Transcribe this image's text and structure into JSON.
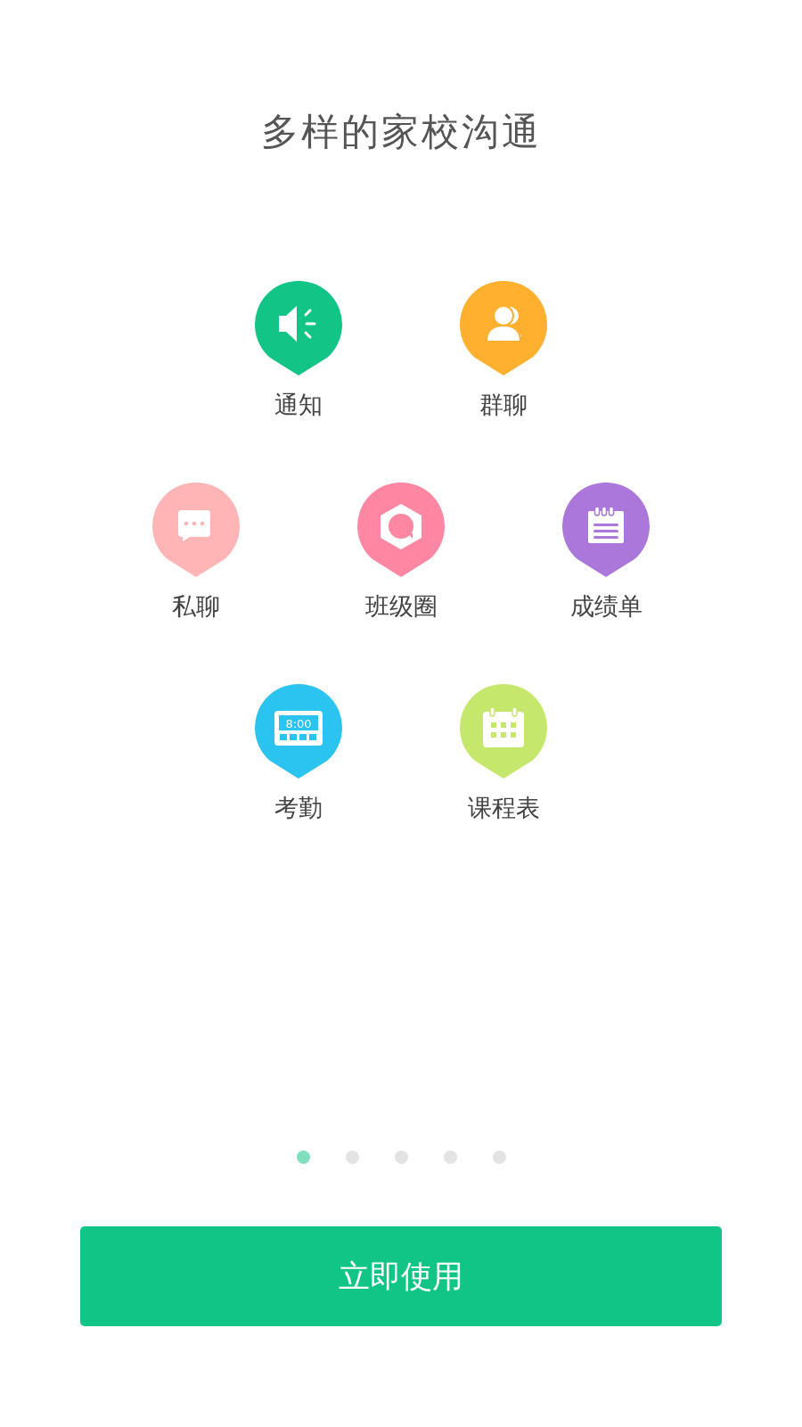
{
  "title": "多样的家校沟通",
  "feature_rows": [
    [
      {
        "kind": "megaphone",
        "label": "通知",
        "color": "#12c587"
      },
      {
        "kind": "people",
        "label": "群聊",
        "color": "#ffb02e"
      }
    ],
    [
      {
        "kind": "chat",
        "label": "私聊",
        "color": "#ffb5b5"
      },
      {
        "kind": "hexagon",
        "label": "班级圈",
        "color": "#ff87a3"
      },
      {
        "kind": "notepad",
        "label": "成绩单",
        "color": "#ab77da"
      }
    ],
    [
      {
        "kind": "clock",
        "label": "考勤",
        "color": "#2bc3f0",
        "clock_text": "8:00"
      },
      {
        "kind": "calendar",
        "label": "课程表",
        "color": "#c5e86c"
      }
    ]
  ],
  "pager": [
    {
      "selected": true
    },
    {
      "selected": false
    },
    {
      "selected": false
    },
    {
      "selected": false
    },
    {
      "selected": false
    }
  ],
  "button": {
    "label": "立即使用"
  }
}
